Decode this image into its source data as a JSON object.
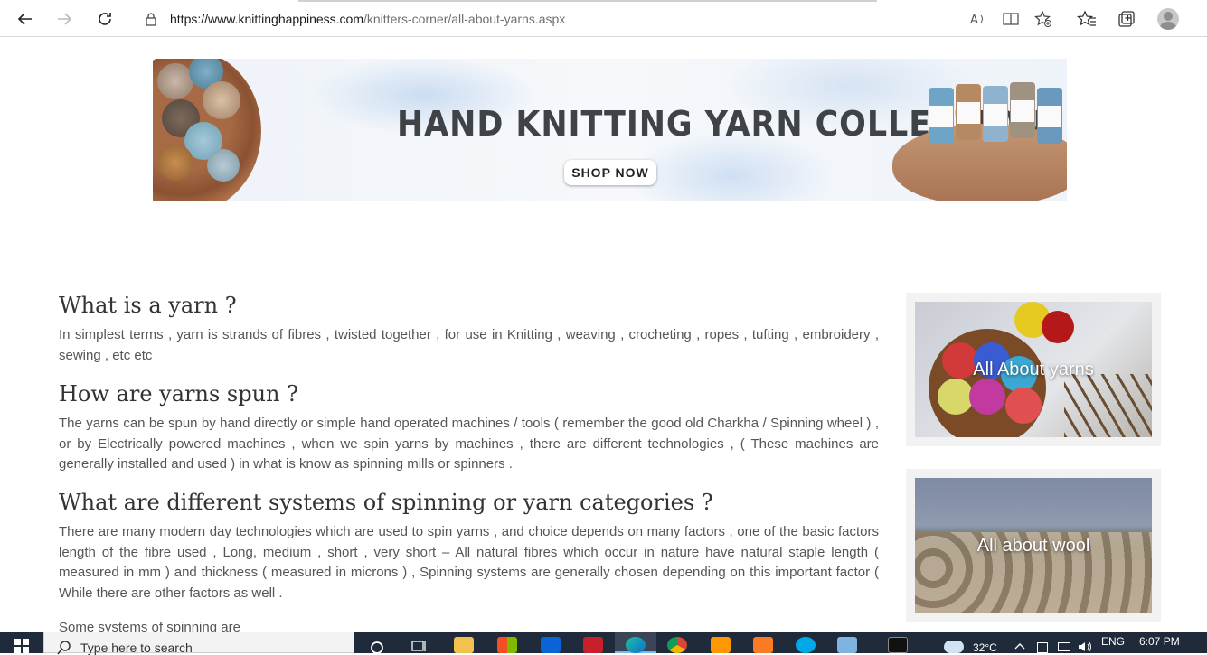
{
  "browser": {
    "url_domain": "https://www.knittinghappiness.com",
    "url_path": "/knitters-corner/all-about-yarns.aspx"
  },
  "banner": {
    "title": "HAND KNITTING YARN COLLECTION",
    "button": "SHOP NOW"
  },
  "article": {
    "q1": "What is a yarn ?",
    "a1": "In simplest terms , yarn is strands of fibres , twisted together , for use in Knitting , weaving , crocheting , ropes , tufting , embroidery , sewing , etc etc",
    "q2": "How are yarns spun ?",
    "a2": "The yarns can be spun by hand directly or simple hand operated machines / tools ( remember the good old Charkha / Spinning wheel ) , or by Electrically powered machines , when we spin yarns by machines , there are different technologies , ( These machines are generally installed and used ) in what is know as spinning mills or spinners .",
    "q3": "What are different systems of spinning or yarn categories ?",
    "a3": "There are many modern day technologies which are used to spin yarns , and choice depends on many factors , one of the basic factors length of the fibre used , Long, medium , short , very short – All natural fibres which occur in nature have natural staple length ( measured in mm ) and thickness ( measured in microns ) , Spinning systems are generally chosen depending on this important factor ( While there are other factors as well .",
    "a4": "Some systems of spinning are"
  },
  "sidebar": {
    "card1": "All About yarns",
    "card2": "All about wool"
  },
  "taskbar": {
    "search_placeholder": "Type here to search",
    "weather": "32°C",
    "language": "ENG",
    "time": "6:07 PM"
  }
}
